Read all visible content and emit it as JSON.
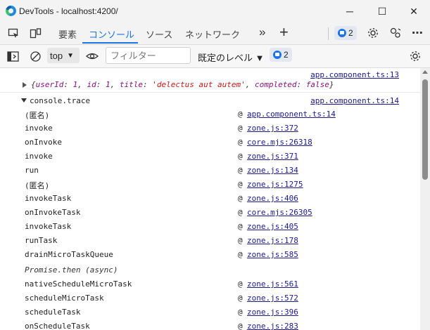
{
  "window": {
    "title": "DevTools - localhost:4200/",
    "minimize": "─",
    "maximize": "☐",
    "close": "✕"
  },
  "tabs": {
    "items": [
      "要素",
      "コンソール",
      "ソース",
      "ネットワーク"
    ],
    "active": "コンソール",
    "more": "»",
    "add": "+",
    "issues_count": "2"
  },
  "toolbar": {
    "context": "top",
    "filter_placeholder": "フィルター",
    "levels": "既定のレベル ▼",
    "issues_count": "2"
  },
  "console": {
    "object_source": "app.component.ts:13",
    "object_text": {
      "k1": "userId",
      "v1": "1",
      "k2": "id",
      "v2": "1",
      "k3": "title",
      "v3": "'delectus aut autem'",
      "k4": "completed",
      "v4": "false"
    },
    "trace_label": "console.trace",
    "trace_source": "app.component.ts:14",
    "frames": [
      {
        "fn": "(匿名)",
        "at": "@",
        "src": "app.component.ts:14"
      },
      {
        "fn": "invoke",
        "at": "@",
        "src": "zone.js:372"
      },
      {
        "fn": "onInvoke",
        "at": "@",
        "src": "core.mjs:26318"
      },
      {
        "fn": "invoke",
        "at": "@",
        "src": "zone.js:371"
      },
      {
        "fn": "run",
        "at": "@",
        "src": "zone.js:134"
      },
      {
        "fn": "(匿名)",
        "at": "@",
        "src": "zone.js:1275"
      },
      {
        "fn": "invokeTask",
        "at": "@",
        "src": "zone.js:406"
      },
      {
        "fn": "onInvokeTask",
        "at": "@",
        "src": "core.mjs:26305"
      },
      {
        "fn": "invokeTask",
        "at": "@",
        "src": "zone.js:405"
      },
      {
        "fn": "runTask",
        "at": "@",
        "src": "zone.js:178"
      },
      {
        "fn": "drainMicroTaskQueue",
        "at": "@",
        "src": "zone.js:585"
      }
    ],
    "async_label": "Promise.then (async)",
    "frames2": [
      {
        "fn": "nativeScheduleMicroTask",
        "at": "@",
        "src": "zone.js:561"
      },
      {
        "fn": "scheduleMicroTask",
        "at": "@",
        "src": "zone.js:572"
      },
      {
        "fn": "scheduleTask",
        "at": "@",
        "src": "zone.js:396"
      },
      {
        "fn": "onScheduleTask",
        "at": "@",
        "src": "zone.js:283"
      }
    ]
  }
}
